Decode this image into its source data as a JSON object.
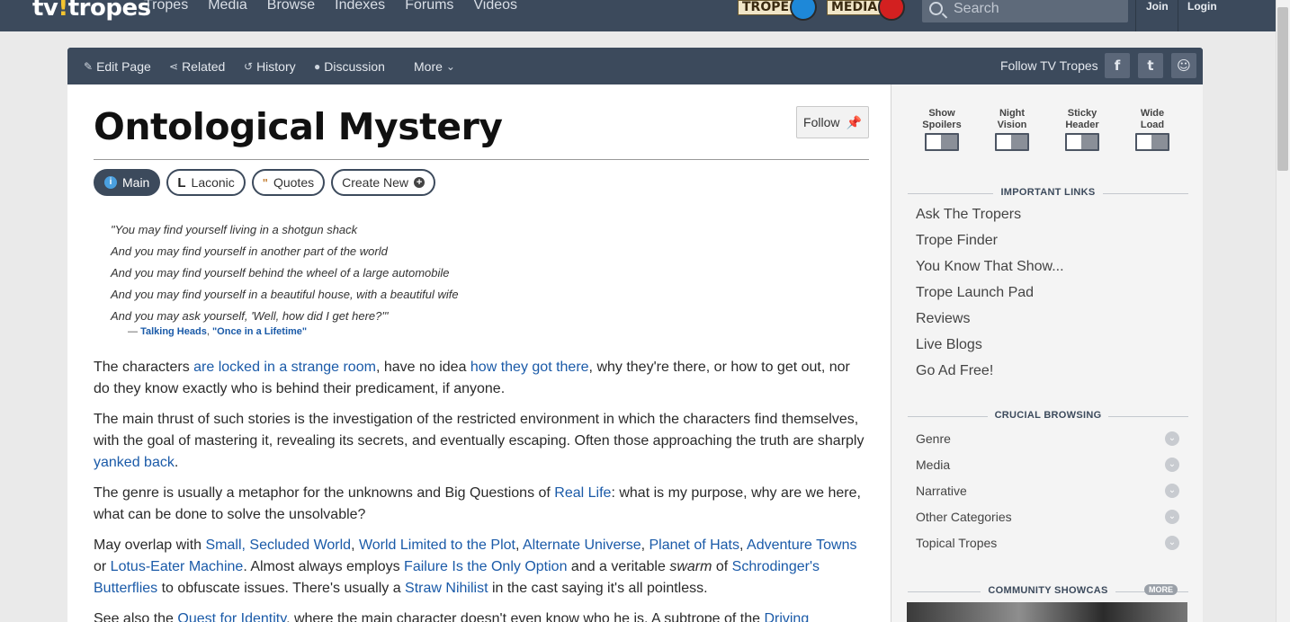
{
  "topbar": {
    "logo_left": "tv",
    "logo_mark": "!",
    "logo_right": "tropes",
    "nav": [
      "Tropes",
      "Media",
      "Browse",
      "Indexes",
      "Forums",
      "Videos"
    ],
    "random_trope_label": "TROPE",
    "random_media_label": "MEDIA",
    "search_placeholder": "Search",
    "join_label": "Join",
    "login_label": "Login"
  },
  "actionbar": {
    "edit_page": "Edit Page",
    "related": "Related",
    "history": "History",
    "discussion": "Discussion",
    "more": "More",
    "follow_tv_tropes": "Follow TV Tropes"
  },
  "page": {
    "title": "Ontological Mystery",
    "follow_label": "Follow",
    "tabs": [
      "Main",
      "Laconic",
      "Quotes",
      "Create New"
    ],
    "quote_lines": [
      "\"You may find yourself living in a shotgun shack",
      "And you may find yourself in another part of the world",
      "And you may find yourself behind the wheel of a large automobile",
      "And you may find yourself in a beautiful house, with a beautiful wife",
      "And you may ask yourself, 'Well, how did I get here?'\""
    ],
    "quote_dash": "—",
    "quote_author": "Talking Heads",
    "quote_source": "\"Once in a Lifetime\"",
    "p1": [
      "The characters ",
      "are locked in a strange room",
      ", have no idea ",
      "how they got there",
      ", why they're there, or how to get out, nor do they know exactly who is behind their predicament, if anyone."
    ],
    "p2": [
      "The main thrust of such stories is the investigation of the restricted environment in which the characters find themselves, with the goal of mastering it, revealing its secrets, and eventually escaping. Often those approaching the truth are sharply ",
      "yanked back",
      "."
    ],
    "p3": [
      "The genre is usually a metaphor for the unknowns and Big Questions of ",
      "Real Life",
      ": what is my purpose, why are we here, what can be done to solve the unsolvable?"
    ],
    "p4": [
      "May overlap with ",
      "Small, Secluded World",
      ", ",
      "World Limited to the Plot",
      ", ",
      "Alternate Universe",
      ", ",
      "Planet of Hats",
      ", ",
      "Adventure Towns",
      " or ",
      "Lotus-Eater Machine",
      ". Almost always employs ",
      "Failure Is the Only Option",
      " and a veritable ",
      "swarm",
      " of ",
      "Schrodinger's Butterflies",
      " to obfuscate issues. There's usually a ",
      "Straw Nihilist",
      " in the cast saying it's all pointless."
    ],
    "p5": [
      "See also the ",
      "Quest for Identity",
      ", where the main character doesn't even know who he is. A subtrope of the ",
      "Driving"
    ]
  },
  "sidebar": {
    "toggles": [
      {
        "line1": "Show",
        "line2": "Spoilers"
      },
      {
        "line1": "Night",
        "line2": "Vision"
      },
      {
        "line1": "Sticky",
        "line2": "Header"
      },
      {
        "line1": "Wide",
        "line2": "Load"
      }
    ],
    "important_links_heading": "IMPORTANT LINKS",
    "important_links": [
      "Ask The Tropers",
      "Trope Finder",
      "You Know That Show...",
      "Trope Launch Pad",
      "Reviews",
      "Live Blogs",
      "Go Ad Free!"
    ],
    "crucial_heading": "CRUCIAL BROWSING",
    "crucial_items": [
      "Genre",
      "Media",
      "Narrative",
      "Other Categories",
      "Topical Tropes"
    ],
    "showcase_heading": "COMMUNITY SHOWCAS",
    "more_badge": "MORE"
  },
  "colors": {
    "header_bg": "#3c4a5c",
    "link": "#1a5aa8",
    "random_trope_ball": "#1e88d8",
    "random_media_ball": "#d32020"
  }
}
